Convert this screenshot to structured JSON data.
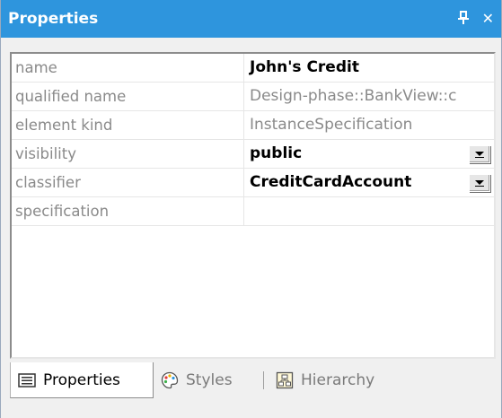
{
  "window": {
    "title": "Properties",
    "pin_glyph": "Ԅ",
    "close_glyph": "✕"
  },
  "properties": [
    {
      "name": "name",
      "value": "John's Credit",
      "readonly": false,
      "dropdown": false
    },
    {
      "name": "qualified name",
      "value": "Design-phase::BankView::c",
      "readonly": true,
      "dropdown": false
    },
    {
      "name": "element kind",
      "value": "InstanceSpecification",
      "readonly": true,
      "dropdown": false
    },
    {
      "name": "visibility",
      "value": "public",
      "readonly": false,
      "dropdown": true
    },
    {
      "name": "classifier",
      "value": "CreditCardAccount",
      "readonly": false,
      "dropdown": true
    },
    {
      "name": "specification",
      "value": "",
      "readonly": false,
      "dropdown": false
    }
  ],
  "tabs": [
    {
      "label": "Properties",
      "icon": "properties-list-icon",
      "active": true
    },
    {
      "label": "Styles",
      "icon": "palette-icon",
      "active": false
    },
    {
      "label": "Hierarchy",
      "icon": "hierarchy-icon",
      "active": false
    }
  ],
  "colors": {
    "title_bar": "#2e95dd",
    "panel_bg": "#f0f0f0",
    "readonly_text": "#8a8a8a"
  }
}
